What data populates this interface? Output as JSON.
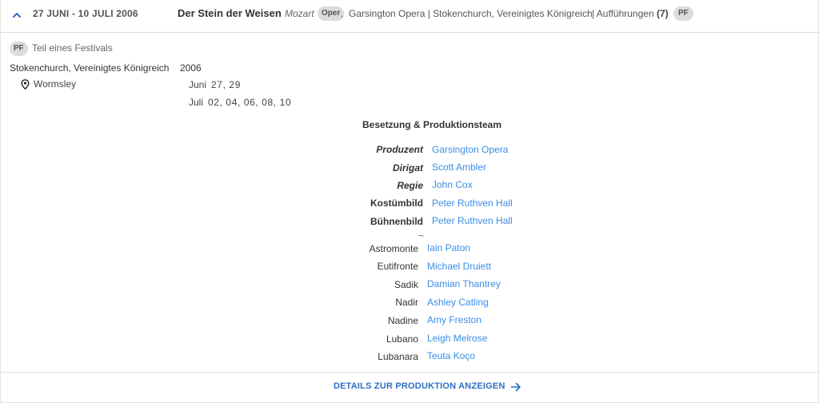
{
  "header": {
    "dates": "27 JUNI - 10 JULI 2006",
    "title": "Der Stein der Weisen",
    "composer": "Mozart",
    "genre_badge": "Oper",
    "venue": "Garsington Opera | Stokenchurch, Vereinigtes Königreich",
    "performances_label": "| Aufführungen",
    "performances_count": "(7)",
    "festival_badge": "PF"
  },
  "festival": {
    "badge": "PF",
    "label": "Teil eines Festivals"
  },
  "location": {
    "city": "Stokenchurch, Vereinigtes Königreich",
    "venue": "Wormsley"
  },
  "schedule": {
    "year": "2006",
    "months": [
      {
        "month": "Juni",
        "days": "27, 29"
      },
      {
        "month": "Juli",
        "days": "02, 04, 06, 08, 10"
      }
    ]
  },
  "cast_title": "Besetzung & Produktionsteam",
  "team": [
    {
      "role": "Produzent",
      "name": "Garsington Opera"
    },
    {
      "role": "Dirigat",
      "name": "Scott Ambler"
    },
    {
      "role": "Regie",
      "name": "John Cox"
    },
    {
      "role": "Kostümbild",
      "name": "Peter Ruthven Hall"
    },
    {
      "role": "Bühnenbild",
      "name": "Peter Ruthven Hall"
    }
  ],
  "separator": "~",
  "cast": [
    {
      "role": "Astromonte",
      "name": "Iain Paton"
    },
    {
      "role": "Eutifronte",
      "name": "Michael Druiett"
    },
    {
      "role": "Sadik",
      "name": "Damian Thantrey"
    },
    {
      "role": "Nadir",
      "name": "Ashley Catling"
    },
    {
      "role": "Nadine",
      "name": "Amy Freston"
    },
    {
      "role": "Lubano",
      "name": "Leigh Melrose"
    },
    {
      "role": "Lubanara",
      "name": "Teuta Koço"
    }
  ],
  "details_link": "DETAILS ZUR PRODUKTION ANZEIGEN",
  "colors": {
    "link": "#3a8ee6",
    "accent": "#2d6fc2",
    "badge_bg": "#dcdcdc"
  },
  "icons": {
    "collapse": "chevron-up-icon",
    "location": "map-pin-icon",
    "arrow": "arrow-right-icon"
  }
}
